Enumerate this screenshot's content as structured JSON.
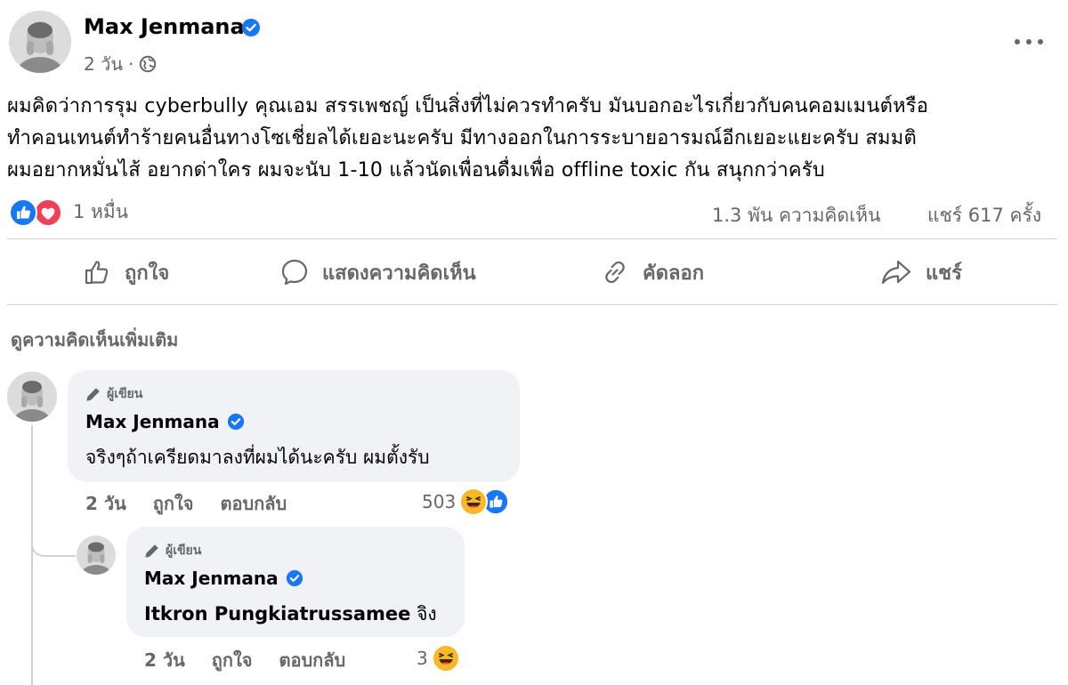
{
  "post": {
    "author": "Max Jenmana",
    "time": "2 วัน",
    "separator": "·",
    "lines": [
      "ผมคิดว่าการรุม cyberbully คุณเอม สรรเพชญ์ เป็นสิ่งที่ไม่ควรทำครับ มันบอกอะไรเกี่ยวกับคนคอมเมนต์หรือ",
      "ทำคอนเทนต์ทำร้ายคนอื่นทางโซเชี่ยลได้เยอะนะครับ มีทางออกในการระบายอารมณ์อีกเยอะแยะครับ สมมติ",
      "ผมอยากหมั่นไส้ อยากด่าใคร ผมจะนับ 1-10 แล้วนัดเพื่อนดื่มเพื่อ offline toxic กัน สนุกกว่าครับ"
    ],
    "reactions_count": "1 หมื่น",
    "comments_count": "1.3 พัน ความคิดเห็น",
    "shares_count": "แชร์ 617 ครั้ง"
  },
  "actions": {
    "like": "ถูกใจ",
    "comment": "แสดงความคิดเห็น",
    "copy": "คัดลอก",
    "share": "แชร์"
  },
  "more_comments": "ดูความคิดเห็นเพิ่มเติม",
  "comments": [
    {
      "tag": "ผู้เขียน",
      "author": "Max Jenmana",
      "text": "จริงๆถ้าเครียดมาลงที่ผมได้นะครับ ผมตั้งรับ",
      "time": "2 วัน",
      "like": "ถูกใจ",
      "reply": "ตอบกลับ",
      "reaction_count": "503"
    },
    {
      "tag": "ผู้เขียน",
      "author": "Max Jenmana",
      "mention": "Itkron Pungkiatrussamee",
      "text": "จิง",
      "time": "2 วัน",
      "like": "ถูกใจ",
      "reply": "ตอบกลับ",
      "reaction_count": "3"
    }
  ],
  "colors": {
    "verified": "#1877f2",
    "like_blue": "#1877f2",
    "love_red": "#f33e58",
    "haha_yellow": "#f7b928",
    "meta_gray": "#65676b"
  }
}
